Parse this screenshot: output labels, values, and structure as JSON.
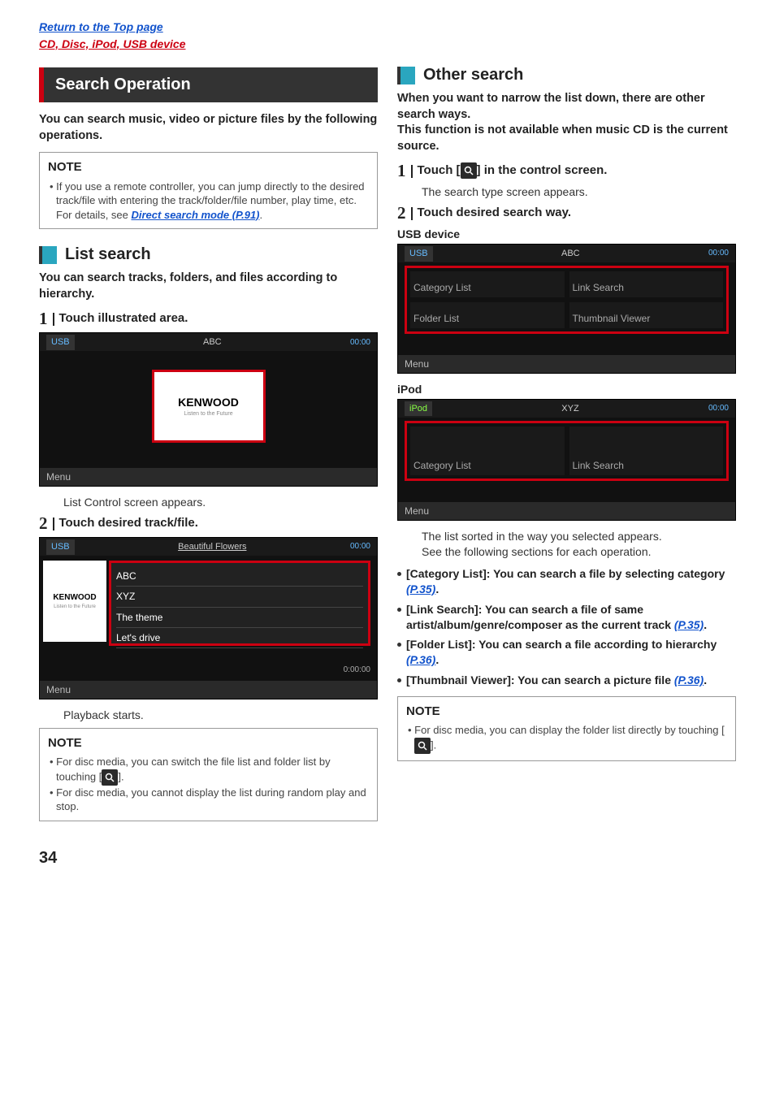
{
  "top_links": {
    "return": "Return to the Top page",
    "section": "CD, Disc, iPod, USB device"
  },
  "left": {
    "section_title": "Search Operation",
    "lead": "You can search music, video or picture files by the following operations.",
    "note1": {
      "title": "NOTE",
      "body_prefix": "• If you use a remote controller, you can jump directly to the desired track/file with entering the track/folder/file number, play time, etc. For details, see ",
      "link": "Direct search mode (P.91)",
      "body_suffix": "."
    },
    "subhead": "List search",
    "sublead": "You can search tracks, folders, and files according to hierarchy.",
    "step1_num": "1",
    "step1_text": "Touch illustrated area.",
    "step1_body": "List Control screen appears.",
    "step2_num": "2",
    "step2_text": "Touch desired track/file.",
    "step2_body": "Playback starts.",
    "img1": {
      "tag": "USB",
      "title": "ABC",
      "time": "00:00",
      "logo": "KENWOOD",
      "logo_sub": "Listen to the Future",
      "menu": "Menu"
    },
    "img2": {
      "tag": "USB",
      "title": "Beautiful Flowers",
      "time": "00:00",
      "left_logo": "KENWOOD",
      "left_logo_sub": "Listen to the Future",
      "list": [
        "ABC",
        "XYZ",
        "The theme",
        "Let's drive"
      ],
      "playtime": "0:00:00",
      "menu": "Menu"
    },
    "note2": {
      "title": "NOTE",
      "line1": "• For disc media, you can switch the file list and folder list by touching [",
      "line1_end": "].",
      "line2": "• For disc media, you cannot display the list during random play and stop."
    }
  },
  "right": {
    "subhead": "Other search",
    "lead": "When you want to narrow the list down, there are other search ways.\nThis function is not available when music CD is the current source.",
    "step1_num": "1",
    "step1_text_pre": "Touch [",
    "step1_text_post": "] in the control screen.",
    "step1_body": "The search type screen appears.",
    "step2_num": "2",
    "step2_text": "Touch desired search way.",
    "label_usb": "USB device",
    "label_ipod": "iPod",
    "img_usb": {
      "tag": "USB",
      "title": "ABC",
      "time": "00:00",
      "cats": [
        "Category List",
        "Link Search",
        "Folder List",
        "Thumbnail Viewer"
      ],
      "menu": "Menu"
    },
    "img_ipod": {
      "tag": "iPod",
      "title": "XYZ",
      "time": "00:00",
      "cats": [
        "Category List",
        "Link Search"
      ],
      "menu": "Menu"
    },
    "result_body": "The list sorted in the way you selected appears.\nSee the following sections for each operation.",
    "bullets": [
      {
        "text": "[Category List]: You can search a file by selecting category ",
        "link": "(P.35)",
        "suffix": "."
      },
      {
        "text": "[Link Search]: You can search a file of same artist/album/genre/composer as the current track ",
        "link": "(P.35)",
        "suffix": "."
      },
      {
        "text": "[Folder List]: You can search a file according to hierarchy ",
        "link": "(P.36)",
        "suffix": "."
      },
      {
        "text": "[Thumbnail Viewer]: You can search a picture file ",
        "link": "(P.36)",
        "suffix": "."
      }
    ],
    "note": {
      "title": "NOTE",
      "line": "• For disc media, you can display the folder list directly by touching [",
      "line_end": "]."
    }
  },
  "page_num": "34"
}
